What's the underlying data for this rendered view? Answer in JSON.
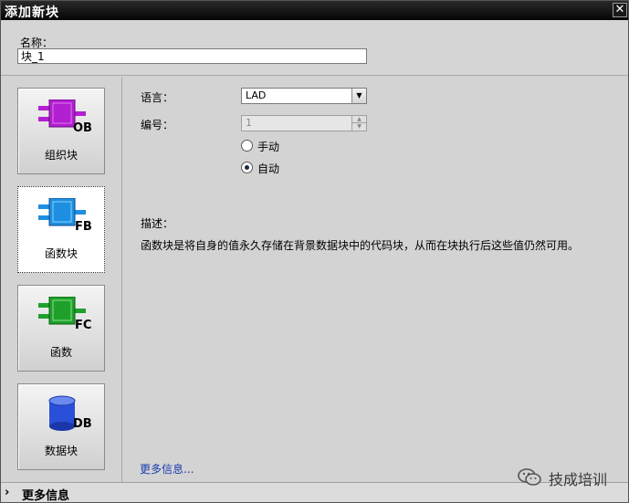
{
  "window": {
    "title": "添加新块",
    "close_glyph": "✕"
  },
  "name_field": {
    "label": "名称：",
    "value": "块_1"
  },
  "block_types": [
    {
      "code": "OB",
      "label": "组织块",
      "color": "#b21fd0",
      "selected": false
    },
    {
      "code": "FB",
      "label": "函数块",
      "color": "#1e8fe0",
      "selected": true
    },
    {
      "code": "FC",
      "label": "函数",
      "color": "#1fa02a",
      "selected": false
    },
    {
      "code": "DB",
      "label": "数据块",
      "color": "#2a4fd8",
      "selected": false
    }
  ],
  "form": {
    "language_label": "语言：",
    "language_value": "LAD",
    "number_label": "编号：",
    "number_value": "1",
    "radio_manual": "手动",
    "radio_auto": "自动",
    "radio_selected": "auto"
  },
  "description": {
    "label": "描述：",
    "text": "函数块是将自身的值永久存储在背景数据块中的代码块，从而在块执行后这些值仍然可用。"
  },
  "links": {
    "more_info": "更多信息..."
  },
  "bottom_bar": {
    "label": "更多信息",
    "chevron": "›"
  },
  "watermark": {
    "text": "技成培训",
    "icon": "wechat-icon"
  }
}
